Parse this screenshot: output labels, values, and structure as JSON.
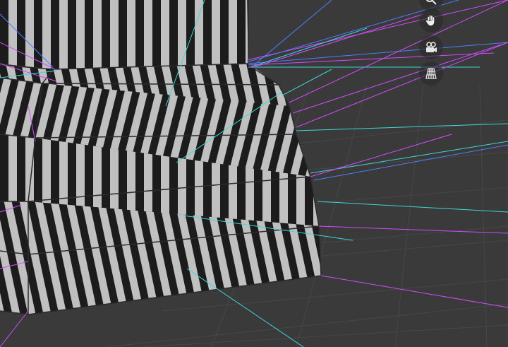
{
  "viewport": {
    "background": "#3a3a3a",
    "grid_color": "#474747",
    "stripe_dark": "#1c1c1c",
    "stripe_light": "#c0c0c0",
    "edge_color": "#2b2b2b",
    "normal_colors": [
      "#d24bff",
      "#3fd6d6",
      "#4f7dff"
    ]
  },
  "navigation_gizmo": {
    "buttons": [
      {
        "icon": "zoom-icon",
        "partially_visible": true
      },
      {
        "icon": "hand-pan-icon"
      },
      {
        "icon": "camera-icon"
      },
      {
        "icon": "perspective-grid-icon"
      }
    ]
  }
}
